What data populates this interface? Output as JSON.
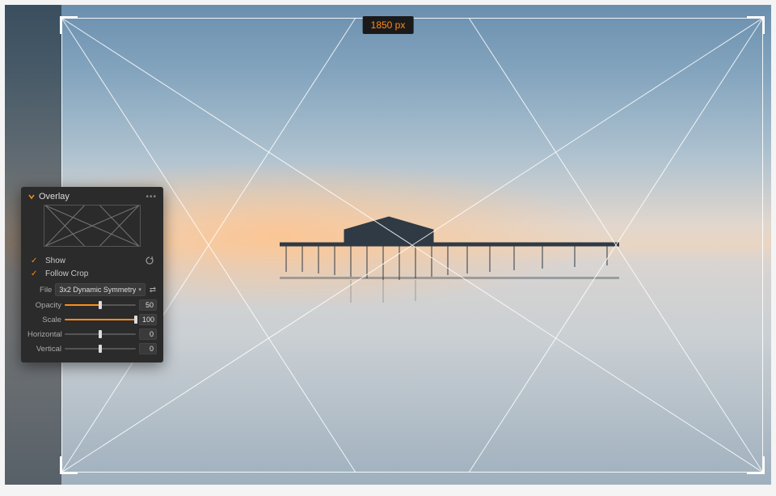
{
  "crop": {
    "width_label": "1850 px"
  },
  "panel": {
    "title": "Overlay",
    "show": {
      "label": "Show",
      "checked": true
    },
    "follow_crop": {
      "label": "Follow Crop",
      "checked": true
    },
    "file": {
      "label": "File",
      "value": "3x2 Dynamic Symmetry"
    },
    "opacity": {
      "label": "Opacity",
      "value": 50,
      "pct": 50
    },
    "scale": {
      "label": "Scale",
      "value": 100,
      "pct": 100
    },
    "horizontal": {
      "label": "Horizontal",
      "value": 0,
      "pct": 50
    },
    "vertical": {
      "label": "Vertical",
      "value": 0,
      "pct": 50
    }
  }
}
